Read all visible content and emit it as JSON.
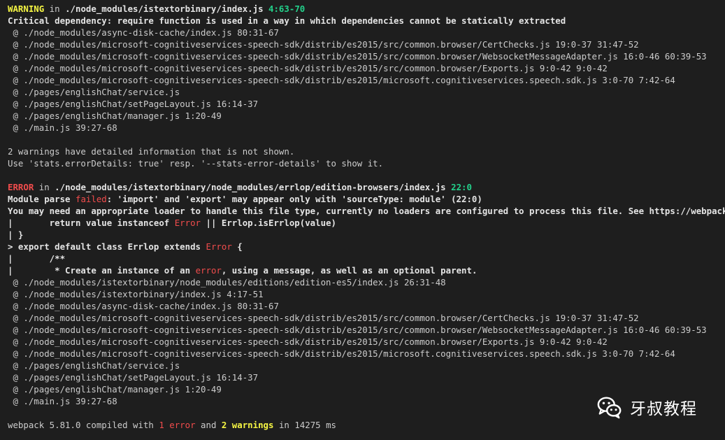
{
  "terminal": {
    "lines": [
      [
        {
          "t": "WARNING",
          "s": "warn-tag"
        },
        {
          "t": " in ",
          "s": ""
        },
        {
          "t": "./node_modules/istextorbinary/index.js",
          "s": "bold"
        },
        {
          "t": " ",
          "s": ""
        },
        {
          "t": "4:63-70",
          "s": "loc"
        }
      ],
      [
        {
          "t": "Critical dependency: require function is used in a way in which dependencies cannot be statically extracted",
          "s": "bold"
        }
      ],
      [
        {
          "t": " @ ./node_modules/async-disk-cache/index.js 80:31-67",
          "s": ""
        }
      ],
      [
        {
          "t": " @ ./node_modules/microsoft-cognitiveservices-speech-sdk/distrib/es2015/src/common.browser/CertChecks.js 19:0-37 31:47-52",
          "s": ""
        }
      ],
      [
        {
          "t": " @ ./node_modules/microsoft-cognitiveservices-speech-sdk/distrib/es2015/src/common.browser/WebsocketMessageAdapter.js 16:0-46 60:39-53",
          "s": ""
        }
      ],
      [
        {
          "t": " @ ./node_modules/microsoft-cognitiveservices-speech-sdk/distrib/es2015/src/common.browser/Exports.js 9:0-42 9:0-42",
          "s": ""
        }
      ],
      [
        {
          "t": " @ ./node_modules/microsoft-cognitiveservices-speech-sdk/distrib/es2015/microsoft.cognitiveservices.speech.sdk.js 3:0-70 7:42-64",
          "s": ""
        }
      ],
      [
        {
          "t": " @ ./pages/englishChat/service.js",
          "s": ""
        }
      ],
      [
        {
          "t": " @ ./pages/englishChat/setPageLayout.js 16:14-37",
          "s": ""
        }
      ],
      [
        {
          "t": " @ ./pages/englishChat/manager.js 1:20-49",
          "s": ""
        }
      ],
      [
        {
          "t": " @ ./main.js 39:27-68",
          "s": ""
        }
      ],
      [],
      [
        {
          "t": "2 warnings have detailed information that is not shown.",
          "s": ""
        }
      ],
      [
        {
          "t": "Use 'stats.errorDetails: true' resp. '--stats-error-details' to show it.",
          "s": ""
        }
      ],
      [],
      [
        {
          "t": "ERROR",
          "s": "err-tag"
        },
        {
          "t": " in ",
          "s": ""
        },
        {
          "t": "./node_modules/istextorbinary/node_modules/errlop/edition-browsers/index.js",
          "s": "bold"
        },
        {
          "t": " ",
          "s": ""
        },
        {
          "t": "22:0",
          "s": "loc"
        }
      ],
      [
        {
          "t": "Module parse ",
          "s": "bold"
        },
        {
          "t": "failed",
          "s": "red"
        },
        {
          "t": ": 'import' and 'export' may appear only with 'sourceType: module' (22:0)",
          "s": "bold"
        }
      ],
      [
        {
          "t": "You may need an appropriate loader to handle this file type, currently no loaders are configured to process this file. See https://webpack.js.org/con",
          "s": "bold"
        }
      ],
      [
        {
          "t": "|       return value instanceof ",
          "s": "bold"
        },
        {
          "t": "Error",
          "s": "red"
        },
        {
          "t": " || Errlop.isErrlop(value)",
          "s": "bold"
        }
      ],
      [
        {
          "t": "| }",
          "s": "bold"
        }
      ],
      [
        {
          "t": "> export default class Errlop extends ",
          "s": "bold"
        },
        {
          "t": "Error",
          "s": "red"
        },
        {
          "t": " {",
          "s": "bold"
        }
      ],
      [
        {
          "t": "|       /**",
          "s": "bold"
        }
      ],
      [
        {
          "t": "|        * Create an instance of an ",
          "s": "bold"
        },
        {
          "t": "error",
          "s": "red"
        },
        {
          "t": ", using a message, as well as an optional parent.",
          "s": "bold"
        }
      ],
      [
        {
          "t": " @ ./node_modules/istextorbinary/node_modules/editions/edition-es5/index.js 26:31-48",
          "s": ""
        }
      ],
      [
        {
          "t": " @ ./node_modules/istextorbinary/index.js 4:17-51",
          "s": ""
        }
      ],
      [
        {
          "t": " @ ./node_modules/async-disk-cache/index.js 80:31-67",
          "s": ""
        }
      ],
      [
        {
          "t": " @ ./node_modules/microsoft-cognitiveservices-speech-sdk/distrib/es2015/src/common.browser/CertChecks.js 19:0-37 31:47-52",
          "s": ""
        }
      ],
      [
        {
          "t": " @ ./node_modules/microsoft-cognitiveservices-speech-sdk/distrib/es2015/src/common.browser/WebsocketMessageAdapter.js 16:0-46 60:39-53",
          "s": ""
        }
      ],
      [
        {
          "t": " @ ./node_modules/microsoft-cognitiveservices-speech-sdk/distrib/es2015/src/common.browser/Exports.js 9:0-42 9:0-42",
          "s": ""
        }
      ],
      [
        {
          "t": " @ ./node_modules/microsoft-cognitiveservices-speech-sdk/distrib/es2015/microsoft.cognitiveservices.speech.sdk.js 3:0-70 7:42-64",
          "s": ""
        }
      ],
      [
        {
          "t": " @ ./pages/englishChat/service.js",
          "s": ""
        }
      ],
      [
        {
          "t": " @ ./pages/englishChat/setPageLayout.js 16:14-37",
          "s": ""
        }
      ],
      [
        {
          "t": " @ ./pages/englishChat/manager.js 1:20-49",
          "s": ""
        }
      ],
      [
        {
          "t": " @ ./main.js 39:27-68",
          "s": ""
        }
      ],
      [],
      [
        {
          "t": "webpack 5.81.0 compiled with ",
          "s": ""
        },
        {
          "t": "1 error",
          "s": "red"
        },
        {
          "t": " and ",
          "s": ""
        },
        {
          "t": "2 warnings",
          "s": "yellow"
        },
        {
          "t": " in 14275 ms",
          "s": ""
        }
      ]
    ]
  },
  "watermark": {
    "icon": "wechat-icon",
    "text": "牙叔教程"
  },
  "colors": {
    "background": "#1e1e1e",
    "text": "#cccccc",
    "warning": "#f5f543",
    "error": "#f14c4c",
    "location": "#23d18b"
  }
}
